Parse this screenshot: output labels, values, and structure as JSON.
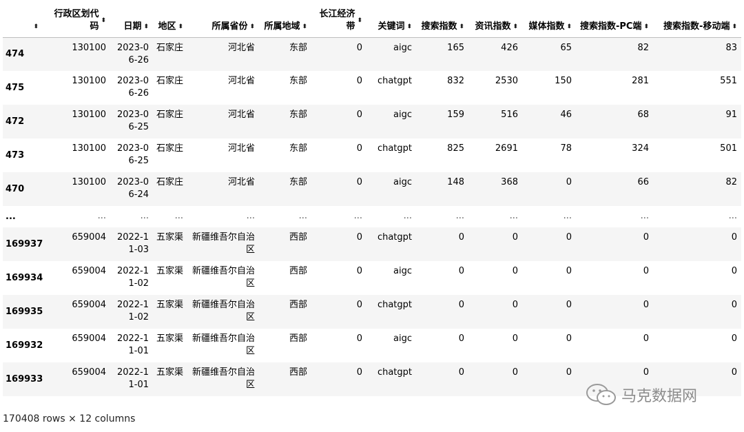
{
  "table": {
    "columns": [
      {
        "label": "",
        "width": 58
      },
      {
        "label": "行政区划代码",
        "width": 98
      },
      {
        "label": "日期",
        "width": 62
      },
      {
        "label": "地区",
        "width": 50
      },
      {
        "label": "所属省份",
        "width": 104
      },
      {
        "label": "所属地域",
        "width": 76
      },
      {
        "label": "长江经济带",
        "width": 80
      },
      {
        "label": "关键词",
        "width": 72
      },
      {
        "label": "搜索指数",
        "width": 76
      },
      {
        "label": "资讯指数",
        "width": 78
      },
      {
        "label": "媒体指数",
        "width": 78
      },
      {
        "label": "搜索指数-PC端",
        "width": 112
      },
      {
        "label": "搜索指数-移动端",
        "width": 128
      }
    ],
    "rows": [
      [
        "474",
        "130100",
        "2023-06-26",
        "石家庄",
        "河北省",
        "东部",
        "0",
        "aigc",
        "165",
        "426",
        "65",
        "82",
        "83"
      ],
      [
        "475",
        "130100",
        "2023-06-26",
        "石家庄",
        "河北省",
        "东部",
        "0",
        "chatgpt",
        "832",
        "2530",
        "150",
        "281",
        "551"
      ],
      [
        "472",
        "130100",
        "2023-06-25",
        "石家庄",
        "河北省",
        "东部",
        "0",
        "aigc",
        "159",
        "516",
        "46",
        "68",
        "91"
      ],
      [
        "473",
        "130100",
        "2023-06-25",
        "石家庄",
        "河北省",
        "东部",
        "0",
        "chatgpt",
        "825",
        "2691",
        "78",
        "324",
        "501"
      ],
      [
        "470",
        "130100",
        "2023-06-24",
        "石家庄",
        "河北省",
        "东部",
        "0",
        "aigc",
        "148",
        "368",
        "0",
        "66",
        "82"
      ],
      [
        "...",
        "...",
        "...",
        "...",
        "...",
        "...",
        "...",
        "...",
        "...",
        "...",
        "...",
        "...",
        "..."
      ],
      [
        "169937",
        "659004",
        "2022-11-03",
        "五家渠",
        "新疆维吾尔自治区",
        "西部",
        "0",
        "chatgpt",
        "0",
        "0",
        "0",
        "0",
        "0"
      ],
      [
        "169934",
        "659004",
        "2022-11-02",
        "五家渠",
        "新疆维吾尔自治区",
        "西部",
        "0",
        "aigc",
        "0",
        "0",
        "0",
        "0",
        "0"
      ],
      [
        "169935",
        "659004",
        "2022-11-02",
        "五家渠",
        "新疆维吾尔自治区",
        "西部",
        "0",
        "chatgpt",
        "0",
        "0",
        "0",
        "0",
        "0"
      ],
      [
        "169932",
        "659004",
        "2022-11-01",
        "五家渠",
        "新疆维吾尔自治区",
        "西部",
        "0",
        "aigc",
        "0",
        "0",
        "0",
        "0",
        "0"
      ],
      [
        "169933",
        "659004",
        "2022-11-01",
        "五家渠",
        "新疆维吾尔自治区",
        "西部",
        "0",
        "chatgpt",
        "0",
        "0",
        "0",
        "0",
        "0"
      ]
    ],
    "sort_glyph": "⬍"
  },
  "footer": {
    "shape_text": "170408 rows × 12 columns"
  },
  "watermark": {
    "text": "马克数据网",
    "icon": "wechat-icon"
  }
}
